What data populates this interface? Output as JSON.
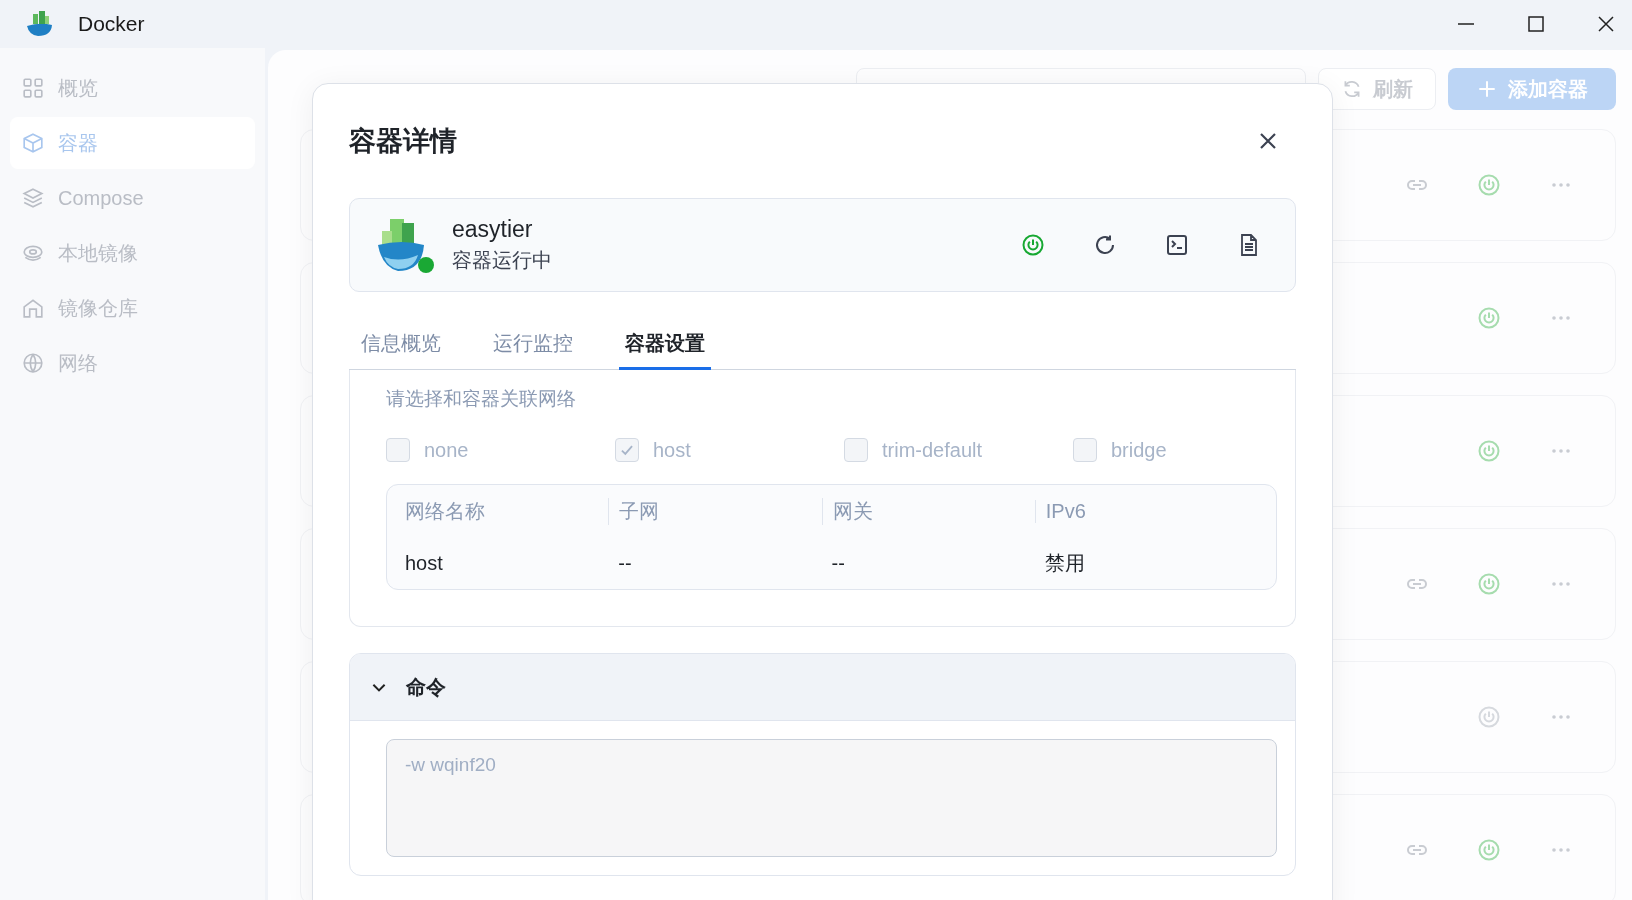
{
  "window": {
    "title": "Docker"
  },
  "sidebar": {
    "items": [
      {
        "label": "概览",
        "selected": false
      },
      {
        "label": "容器",
        "selected": true
      },
      {
        "label": "Compose",
        "selected": false
      },
      {
        "label": "本地镜像",
        "selected": false
      },
      {
        "label": "镜像仓库",
        "selected": false
      },
      {
        "label": "网络",
        "selected": false
      }
    ]
  },
  "toolbar": {
    "refresh_button": "刷新",
    "add_button": "添加容器"
  },
  "container_rows": [
    {
      "link": true,
      "running": true
    },
    {
      "link": false,
      "running": true
    },
    {
      "link": false,
      "running": true
    },
    {
      "link": true,
      "running": true
    },
    {
      "link": false,
      "running": false
    },
    {
      "link": true,
      "running": true
    }
  ],
  "modal": {
    "title": "容器详情",
    "container": {
      "name": "easytier",
      "status": "容器运行中",
      "running": true
    },
    "tabs": [
      {
        "label": "信息概览",
        "selected": false
      },
      {
        "label": "运行监控",
        "selected": false
      },
      {
        "label": "容器设置",
        "selected": true
      }
    ],
    "network_section": {
      "prompt": "请选择和容器关联网络",
      "networks": [
        {
          "label": "none",
          "checked": false,
          "disabled": true
        },
        {
          "label": "host",
          "checked": true,
          "disabled": true
        },
        {
          "label": "trim-default",
          "checked": false,
          "disabled": true
        },
        {
          "label": "bridge",
          "checked": false,
          "disabled": true
        }
      ],
      "table": {
        "columns": [
          "网络名称",
          "子网",
          "网关",
          "IPv6"
        ],
        "rows": [
          [
            "host",
            "--",
            "--",
            "禁用"
          ]
        ]
      }
    },
    "command_section": {
      "title": "命令",
      "expanded": true,
      "value": "-w wqinf20"
    }
  }
}
